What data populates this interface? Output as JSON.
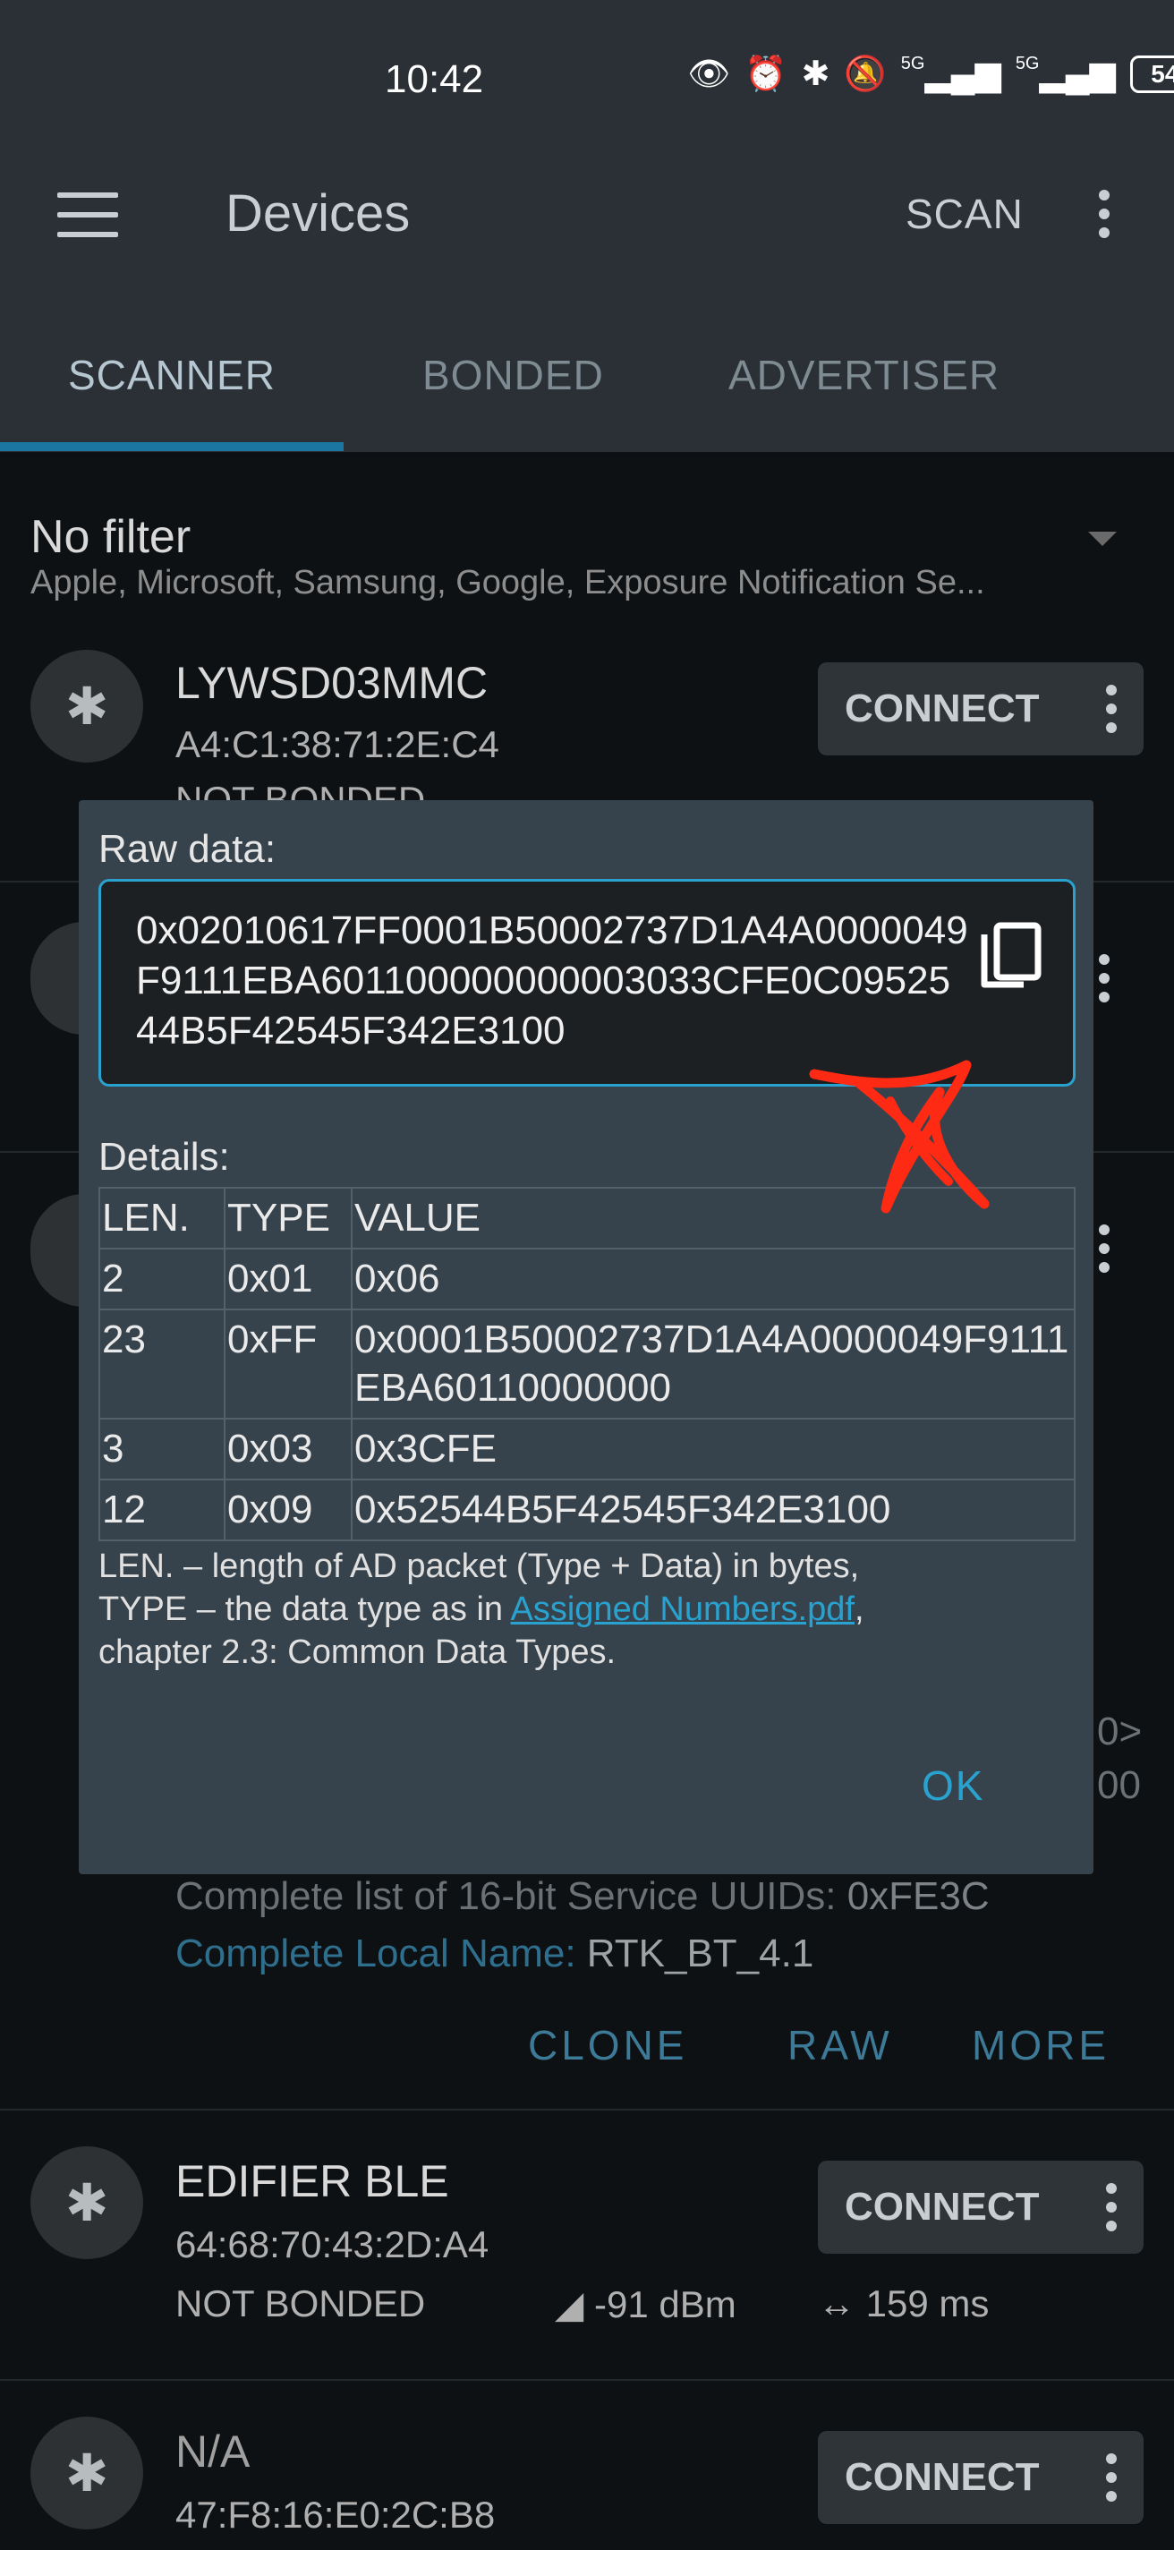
{
  "status_bar": {
    "time": "10:42",
    "signal1": "5G",
    "signal2": "5G",
    "battery": "54"
  },
  "app_bar": {
    "title": "Devices",
    "scan_label": "SCAN"
  },
  "tabs": [
    "SCANNER",
    "BONDED",
    "ADVERTISER"
  ],
  "filter": {
    "title": "No filter",
    "subtitle": "Apple, Microsoft, Samsung, Google, Exposure Notification Se..."
  },
  "devices": [
    {
      "name": "LYWSD03MMC",
      "address": "A4:C1:38:71:2E:C4",
      "bond": "NOT BONDED",
      "connect_label": "CONNECT"
    },
    {
      "name": "EDIFIER BLE",
      "address": "64:68:70:43:2D:A4",
      "bond": "NOT BONDED",
      "rssi": "-91 dBm",
      "interval": "159 ms",
      "connect_label": "CONNECT"
    },
    {
      "name": "N/A",
      "address": "47:F8:16:E0:2C:B8",
      "connect_label": "CONNECT"
    }
  ],
  "background_details": {
    "partial_right_1": "0>",
    "partial_right_2": "00",
    "service_uuids_label": "Complete list of 16-bit Service UUIDs:",
    "service_uuids_value": "0xFE3C",
    "local_name_label": "Complete Local Name:",
    "local_name_value": "RTK_BT_4.1",
    "actions": [
      "CLONE",
      "RAW",
      "MORE"
    ]
  },
  "dialog": {
    "raw_label": "Raw data:",
    "raw_value": "0x02010617FF0001B50002737D1A4A0000049F9111EBA601100000000003033CFE0C0952544B5F42545F342E3100",
    "details_label": "Details:",
    "columns": [
      "LEN.",
      "TYPE",
      "VALUE"
    ],
    "rows": [
      {
        "len": "2",
        "type": "0x01",
        "value": "0x06"
      },
      {
        "len": "23",
        "type": "0xFF",
        "value": "0x0001B50002737D1A4A0000049F9111EBA60110000000"
      },
      {
        "len": "3",
        "type": "0x03",
        "value": "0x3CFE"
      },
      {
        "len": "12",
        "type": "0x09",
        "value": "0x52544B5F42545F342E3100"
      }
    ],
    "legend_line1": "LEN. – length of AD packet (Type + Data) in bytes,",
    "legend_line2_prefix": "TYPE – the data type as in ",
    "legend_link": "Assigned Numbers.pdf",
    "legend_line2_suffix": ",",
    "legend_line3": "chapter 2.3: Common Data Types.",
    "ok_label": "OK"
  },
  "colors": {
    "accent": "#2aa2cf",
    "scribble": "#ff2a14",
    "dialog_bg": "#37434c",
    "appbar_bg": "#2a3036"
  }
}
